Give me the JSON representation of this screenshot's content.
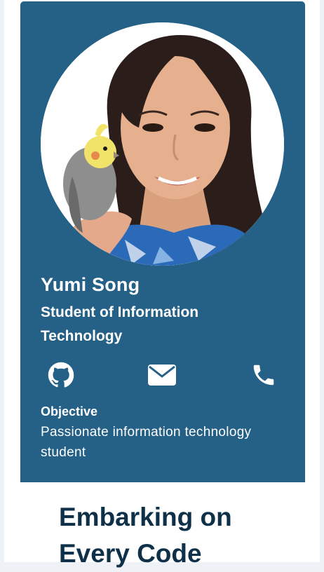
{
  "profile": {
    "name": "Yumi Song",
    "title": "Student of Information Technology",
    "photo_alt": "Yumi Song with a cockatiel"
  },
  "social": {
    "github_icon": "github-icon",
    "email_icon": "envelope-icon",
    "phone_icon": "phone-icon"
  },
  "objective": {
    "heading": "Objective",
    "text": "Passionate information technology student"
  },
  "article": {
    "heading": "Embarking on Every Code"
  },
  "colors": {
    "card_background": "#256087",
    "heading_text": "#0f3049",
    "page_background": "#ffffff"
  }
}
